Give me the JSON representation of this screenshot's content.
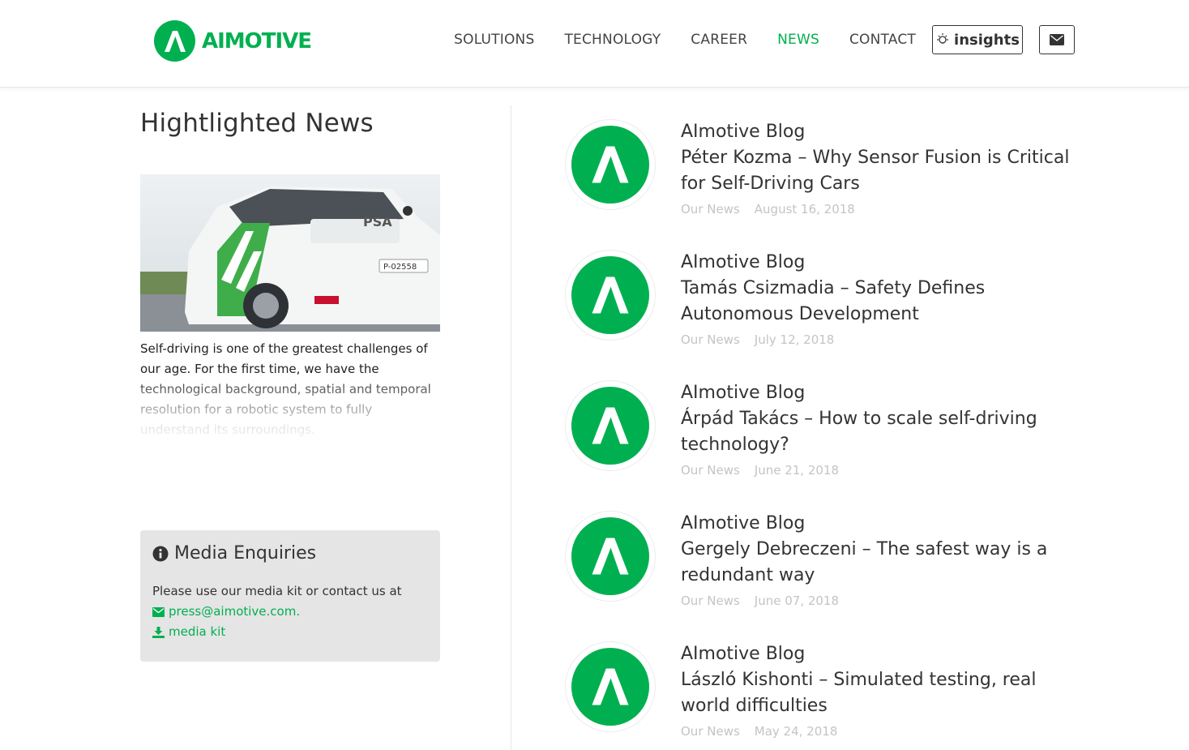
{
  "brand": {
    "name": "AIMOTIVE",
    "color": "#00b050"
  },
  "nav": {
    "items": [
      {
        "label": "SOLUTIONS"
      },
      {
        "label": "TECHNOLOGY"
      },
      {
        "label": "CAREER"
      },
      {
        "label": "NEWS"
      },
      {
        "label": "CONTACT"
      }
    ],
    "active": "NEWS",
    "insights_label": "insights",
    "mail_icon": "envelope-icon"
  },
  "highlight": {
    "title": "Hightlighted News",
    "image_alt": "car-photo",
    "text": "Self-driving is one of the greatest challenges of our age. For the first time, we have the technological background, spatial and temporal resolution for a robotic system to fully understand its surroundings.",
    "car_plate": "P-02558"
  },
  "media": {
    "title": "Media Enquiries",
    "text": "Please use our media kit or contact us at",
    "email": "press@aimotive.com.",
    "kit_label": "media kit"
  },
  "news": [
    {
      "category": "AImotive Blog",
      "title": "Péter Kozma – Why Sensor Fusion is Critical for Self-Driving Cars",
      "tag": "Our News",
      "date": "August 16, 2018"
    },
    {
      "category": "AImotive Blog",
      "title": "Tamás Csizmadia – Safety Defines Autonomous Development",
      "tag": "Our News",
      "date": "July 12, 2018"
    },
    {
      "category": "AImotive Blog",
      "title": "Árpád Takács – How to scale self-driving technology?",
      "tag": "Our News",
      "date": "June 21, 2018"
    },
    {
      "category": "AImotive Blog",
      "title": "Gergely Debreczeni – The safest way is a redundant way",
      "tag": "Our News",
      "date": "June 07, 2018"
    },
    {
      "category": "AImotive Blog",
      "title": "László Kishonti – Simulated testing, real world difficulties",
      "tag": "Our News",
      "date": "May 24, 2018"
    }
  ]
}
